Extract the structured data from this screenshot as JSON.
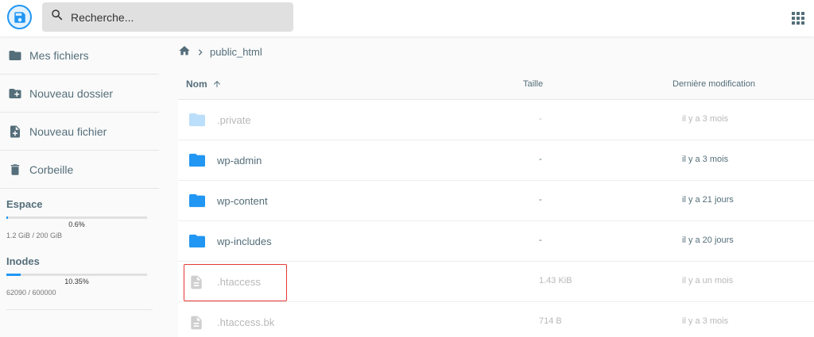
{
  "header": {
    "search_placeholder": "Recherche..."
  },
  "sidebar": {
    "items": [
      {
        "label": "Mes fichiers",
        "icon": "folder-icon"
      },
      {
        "label": "Nouveau dossier",
        "icon": "create-folder-icon"
      },
      {
        "label": "Nouveau fichier",
        "icon": "new-file-icon"
      },
      {
        "label": "Corbeille",
        "icon": "trash-icon"
      }
    ],
    "space": {
      "title": "Espace",
      "percent": "0.6%",
      "fraction": 0.006,
      "used": "1.2 GiB / 200 GiB"
    },
    "inodes": {
      "title": "Inodes",
      "percent": "10.35%",
      "fraction": 0.1035,
      "used": "62090 / 600000"
    }
  },
  "breadcrumb": {
    "path": "public_html"
  },
  "listing": {
    "columns": {
      "name": "Nom",
      "size": "Taille",
      "modified": "Dernière modification"
    },
    "rows": [
      {
        "name": ".private",
        "size": "-",
        "modified": "il y a 3 mois",
        "type": "folder",
        "dim": true
      },
      {
        "name": "wp-admin",
        "size": "-",
        "modified": "il y a 3 mois",
        "type": "folder",
        "dim": false
      },
      {
        "name": "wp-content",
        "size": "-",
        "modified": "il y a 21 jours",
        "type": "folder",
        "dim": false
      },
      {
        "name": "wp-includes",
        "size": "-",
        "modified": "il y a 20 jours",
        "type": "folder",
        "dim": false
      },
      {
        "name": ".htaccess",
        "size": "1.43 KiB",
        "modified": "il y a un mois",
        "type": "file",
        "dim": true
      },
      {
        "name": ".htaccess.bk",
        "size": "714 B",
        "modified": "il y a 3 mois",
        "type": "file",
        "dim": true
      }
    ]
  },
  "colors": {
    "accent": "#2196f3",
    "highlight": "#e53935",
    "text": "#546e7a"
  }
}
